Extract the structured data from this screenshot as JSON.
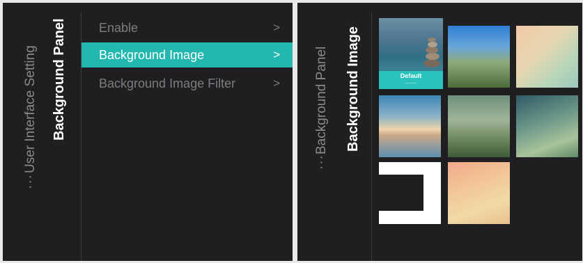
{
  "left_panel": {
    "breadcrumb_dots": "···",
    "breadcrumb_parent": "User Interface Setting",
    "breadcrumb_current": "Background Panel",
    "menu": [
      {
        "label": "Enable",
        "chevron": ">",
        "selected": false
      },
      {
        "label": "Background Image",
        "chevron": ">",
        "selected": true
      },
      {
        "label": "Background Image Filter",
        "chevron": ">",
        "selected": false
      }
    ]
  },
  "right_panel": {
    "breadcrumb_dots": "···",
    "breadcrumb_parent": "Background Panel",
    "breadcrumb_current": "Background Image",
    "thumbnails": [
      {
        "name": "default-pebbles",
        "label": "Default"
      },
      {
        "name": "blurred-sky-green"
      },
      {
        "name": "blurred-pastel-warm"
      },
      {
        "name": "blurred-sunset-blue"
      },
      {
        "name": "blurred-forest-green"
      },
      {
        "name": "blurred-teal-green"
      },
      {
        "name": "white-frame"
      },
      {
        "name": "blurred-peach"
      }
    ]
  },
  "colors": {
    "panel_bg": "#1f1f21",
    "accent": "#22b8b0",
    "text_dim": "#7d7d80",
    "text_bright": "#ffffff"
  }
}
